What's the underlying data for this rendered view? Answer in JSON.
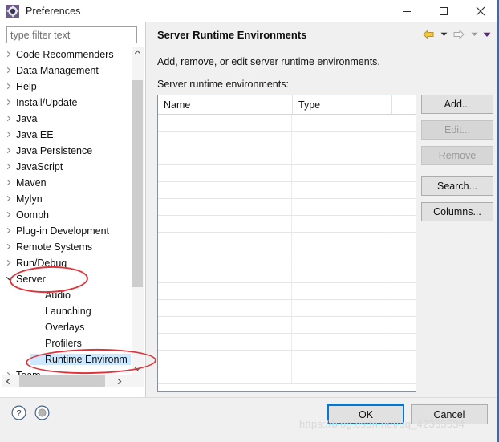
{
  "window": {
    "title": "Preferences",
    "icon": "preferences-gear-icon",
    "controls": {
      "minimize": "minimize-icon",
      "maximize": "maximize-icon",
      "close": "close-icon"
    }
  },
  "filter": {
    "placeholder": "type filter text",
    "value": ""
  },
  "tree": {
    "items": [
      {
        "label": "Code Recommenders",
        "level": 0,
        "expandable": true,
        "expanded": false,
        "selected": false
      },
      {
        "label": "Data Management",
        "level": 0,
        "expandable": true,
        "expanded": false,
        "selected": false
      },
      {
        "label": "Help",
        "level": 0,
        "expandable": true,
        "expanded": false,
        "selected": false
      },
      {
        "label": "Install/Update",
        "level": 0,
        "expandable": true,
        "expanded": false,
        "selected": false
      },
      {
        "label": "Java",
        "level": 0,
        "expandable": true,
        "expanded": false,
        "selected": false
      },
      {
        "label": "Java EE",
        "level": 0,
        "expandable": true,
        "expanded": false,
        "selected": false
      },
      {
        "label": "Java Persistence",
        "level": 0,
        "expandable": true,
        "expanded": false,
        "selected": false
      },
      {
        "label": "JavaScript",
        "level": 0,
        "expandable": true,
        "expanded": false,
        "selected": false
      },
      {
        "label": "Maven",
        "level": 0,
        "expandable": true,
        "expanded": false,
        "selected": false
      },
      {
        "label": "Mylyn",
        "level": 0,
        "expandable": true,
        "expanded": false,
        "selected": false
      },
      {
        "label": "Oomph",
        "level": 0,
        "expandable": true,
        "expanded": false,
        "selected": false
      },
      {
        "label": "Plug-in Development",
        "level": 0,
        "expandable": true,
        "expanded": false,
        "selected": false
      },
      {
        "label": "Remote Systems",
        "level": 0,
        "expandable": true,
        "expanded": false,
        "selected": false
      },
      {
        "label": "Run/Debug",
        "level": 0,
        "expandable": true,
        "expanded": false,
        "selected": false
      },
      {
        "label": "Server",
        "level": 0,
        "expandable": true,
        "expanded": true,
        "selected": false
      },
      {
        "label": "Audio",
        "level": 1,
        "expandable": false,
        "expanded": false,
        "selected": false
      },
      {
        "label": "Launching",
        "level": 1,
        "expandable": false,
        "expanded": false,
        "selected": false
      },
      {
        "label": "Overlays",
        "level": 1,
        "expandable": false,
        "expanded": false,
        "selected": false
      },
      {
        "label": "Profilers",
        "level": 1,
        "expandable": false,
        "expanded": false,
        "selected": false
      },
      {
        "label": "Runtime Environm",
        "level": 1,
        "expandable": false,
        "expanded": false,
        "selected": true
      },
      {
        "label": "Team",
        "level": 0,
        "expandable": true,
        "expanded": false,
        "selected": false
      }
    ]
  },
  "page": {
    "title": "Server Runtime Environments",
    "description": "Add, remove, or edit server runtime environments.",
    "table_label": "Server runtime environments:",
    "nav": {
      "back_icon": "back-arrow-icon",
      "back_menu_icon": "chevron-down-icon",
      "forward_icon": "forward-arrow-icon",
      "forward_menu_icon": "chevron-down-icon",
      "view_menu_icon": "chevron-down-icon"
    }
  },
  "table": {
    "columns": [
      "Name",
      "Type",
      ""
    ],
    "rows": [],
    "empty_row_count": 16
  },
  "side_buttons": [
    {
      "label": "Add...",
      "enabled": true
    },
    {
      "label": "Edit...",
      "enabled": false
    },
    {
      "label": "Remove",
      "enabled": false
    },
    {
      "label": "Search...",
      "enabled": true
    },
    {
      "label": "Columns...",
      "enabled": true
    }
  ],
  "footer": {
    "help_icon": "help-question-icon",
    "apply_icon": "apply-defaults-icon",
    "ok_label": "OK",
    "cancel_label": "Cancel"
  },
  "annotations": {
    "ellipse_server": "Server",
    "ellipse_runtime": "Runtime Environm"
  },
  "watermark": "https://blog.csdn.net/qq_42365534",
  "colors": {
    "accent": "#0078d7",
    "annotation": "#e0343c",
    "selection": "#cde8ff",
    "panel": "#f0f0f0"
  }
}
